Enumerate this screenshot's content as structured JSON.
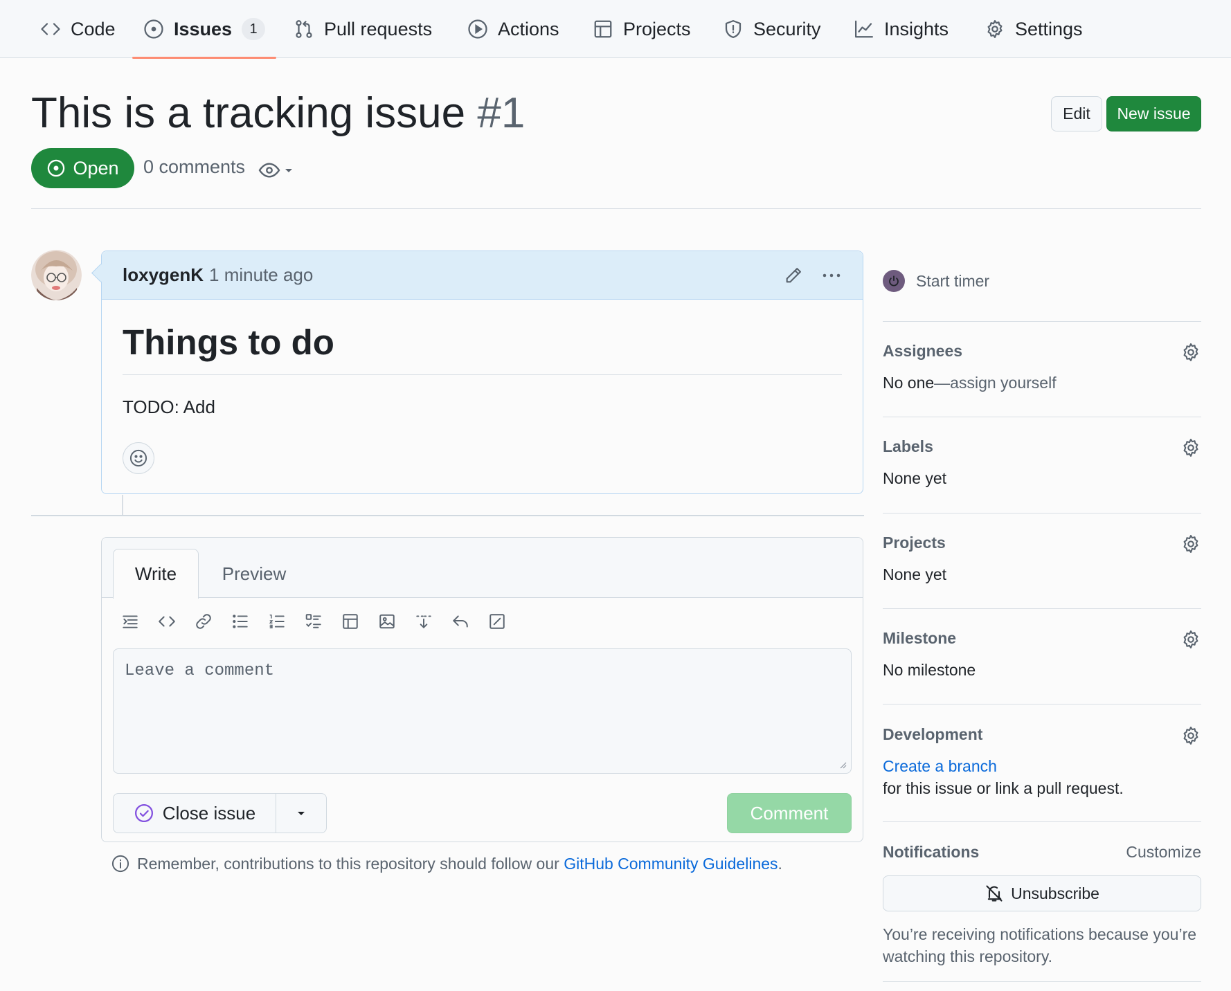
{
  "nav": {
    "items": [
      {
        "label": "Code",
        "icon": "code-icon"
      },
      {
        "label": "Issues",
        "icon": "issue-opened-icon",
        "count": "1",
        "active": true
      },
      {
        "label": "Pull requests",
        "icon": "git-pull-request-icon"
      },
      {
        "label": "Actions",
        "icon": "play-icon"
      },
      {
        "label": "Projects",
        "icon": "table-icon"
      },
      {
        "label": "Security",
        "icon": "shield-icon"
      },
      {
        "label": "Insights",
        "icon": "graph-icon"
      },
      {
        "label": "Settings",
        "icon": "gear-icon"
      }
    ]
  },
  "issue": {
    "title": "This is a tracking issue",
    "number": "#1",
    "state": "Open",
    "comments_count": "0 comments",
    "edit_label": "Edit",
    "new_issue_label": "New issue"
  },
  "comment": {
    "author": "loxygenK",
    "time": "1 minute ago",
    "heading": "Things to do",
    "body": "TODO: Add"
  },
  "composer": {
    "tab_write": "Write",
    "tab_preview": "Preview",
    "placeholder": "Leave a comment",
    "close_issue_label": "Close issue",
    "comment_label": "Comment",
    "toolbar": [
      "heading-icon",
      "code-icon",
      "link-icon",
      "list-unordered-icon",
      "list-ordered-icon",
      "tasklist-icon",
      "table-icon",
      "image-icon",
      "download-icon",
      "reply-icon",
      "edit-icon"
    ]
  },
  "guidelines": {
    "prefix": "Remember, contributions to this repository should follow our ",
    "link": "GitHub Community Guidelines",
    "suffix": "."
  },
  "sidebar": {
    "timer_label": "Start timer",
    "assignees_title": "Assignees",
    "assignees_value_a": "No one",
    "assignees_value_b": "—assign yourself",
    "labels_title": "Labels",
    "labels_value": "None yet",
    "projects_title": "Projects",
    "projects_value": "None yet",
    "milestone_title": "Milestone",
    "milestone_value": "No milestone",
    "development_title": "Development",
    "development_link": "Create a branch",
    "development_text": "for this issue or link a pull request.",
    "notifications_title": "Notifications",
    "customize_label": "Customize",
    "unsubscribe_label": "Unsubscribe",
    "notifications_text": "You’re receiving notifications because you’re watching this repository."
  },
  "colors": {
    "open_green": "#1f883d",
    "link_blue": "#0969da",
    "active_tab_underline": "#fd8c73",
    "comment_header_bg": "#dcedf9"
  }
}
